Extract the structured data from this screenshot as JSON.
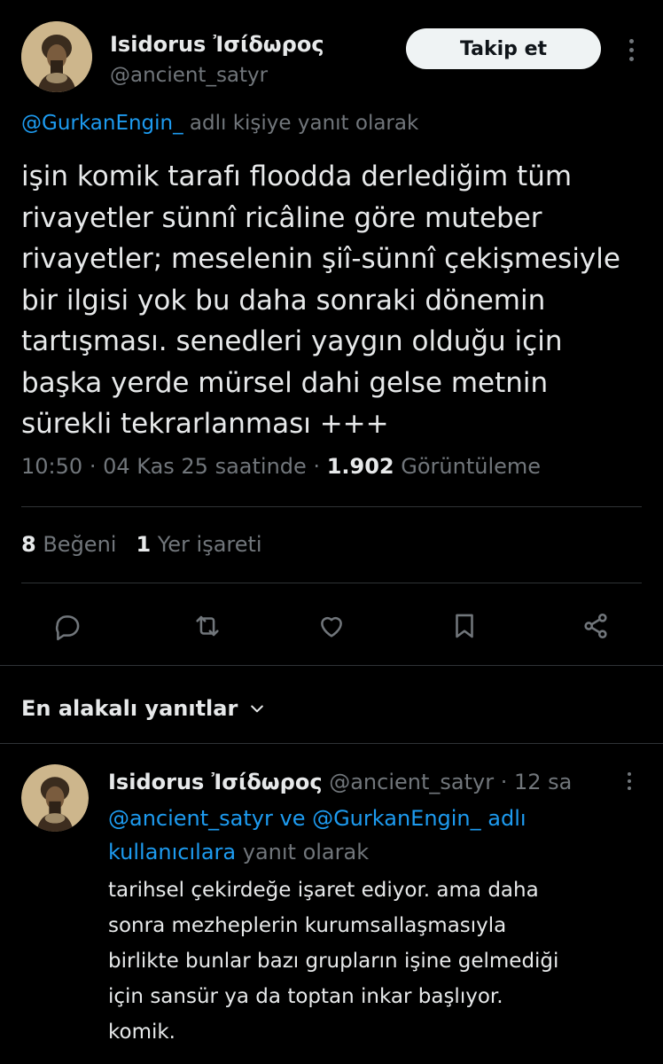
{
  "tweet": {
    "author_name": "Isidorus Ἰσίδωρος",
    "author_handle": "@ancient_satyr",
    "follow_label": "Takip et",
    "reply_to_mention": "@GurkanEngin_",
    "reply_to_suffix": " adlı kişiye yanıt olarak",
    "body_lines": [
      "işin komik tarafı floodda derlediğim tüm",
      "rivayetler sünnî ricâline göre muteber",
      "rivayetler; meselenin şiî-sünnî çekişmesiyle",
      "bir ilgisi yok bu daha sonraki dönemin",
      "tartışması. senedleri yaygın olduğu için",
      "başka yerde mürsel dahi gelse metnin",
      "sürekli tekrarlanması +++"
    ],
    "time": "10:50",
    "date": "04 Kas 25 saatinde",
    "views_count": "1.902",
    "views_label": "Görüntüleme",
    "likes_count": "8",
    "likes_label": "Beğeni",
    "bookmarks_count": "1",
    "bookmarks_label": "Yer işareti",
    "actions": [
      "reply-icon",
      "retweet-icon",
      "like-icon",
      "bookmark-icon",
      "share-icon"
    ]
  },
  "replies_sort": {
    "label": "En alakalı yanıtlar"
  },
  "reply": {
    "author_name": "Isidorus Ἰσίδωρος",
    "author_handle": "@ancient_satyr",
    "time_ago": "12 sa",
    "replying_to_line1": "@ancient_satyr ve @GurkanEngin_ adlı",
    "replying_to_mentions": "kullanıcılara",
    "replying_to_suffix": " yanıt olarak",
    "body_lines": [
      "tarihsel çekirdeğe işaret ediyor. ama daha",
      "sonra mezheplerin kurumsallaşmasıyla",
      "birlikte bunlar bazı grupların işine gelmediği",
      "için sansür ya da toptan inkar başlıyor.",
      "komik."
    ]
  },
  "colors": {
    "background": "#000000",
    "text": "#e7e9ea",
    "muted": "#71767b",
    "link": "#1d9bf0",
    "divider": "#2f3336",
    "follow_bg": "#eff3f4"
  }
}
